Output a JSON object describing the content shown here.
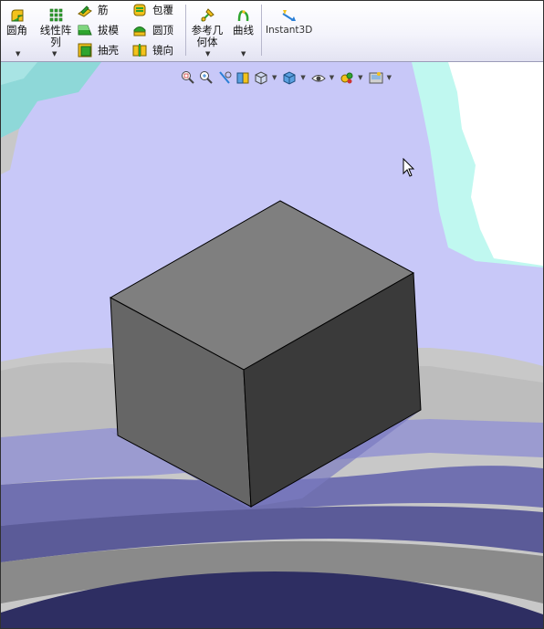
{
  "toolbar": {
    "fillet": "圆角",
    "linear_pattern": "线性阵\n列",
    "rib": "筋",
    "draft": "拔模",
    "shell": "抽壳",
    "wrap": "包覆",
    "dome": "圆顶",
    "mirror": "镜向",
    "reference_geometry": "参考几\n何体",
    "curves": "曲线",
    "instant3d": "Instant3D"
  },
  "heads_up_toolbar": {
    "items": [
      "zoom-to-fit-icon",
      "zoom-to-area-icon",
      "previous-view-icon",
      "section-view-icon",
      "view-orientation-icon",
      "display-style-icon",
      "hide-show-items-icon",
      "edit-appearance-icon",
      "apply-scene-icon"
    ]
  },
  "colors": {
    "accent_green": "#2fa52f",
    "accent_yellow": "#f1c21b",
    "cube_top": "#7f7f7f",
    "cube_left": "#666666",
    "cube_right": "#3a3a3a",
    "background_lavender": "#c8c8f8"
  }
}
